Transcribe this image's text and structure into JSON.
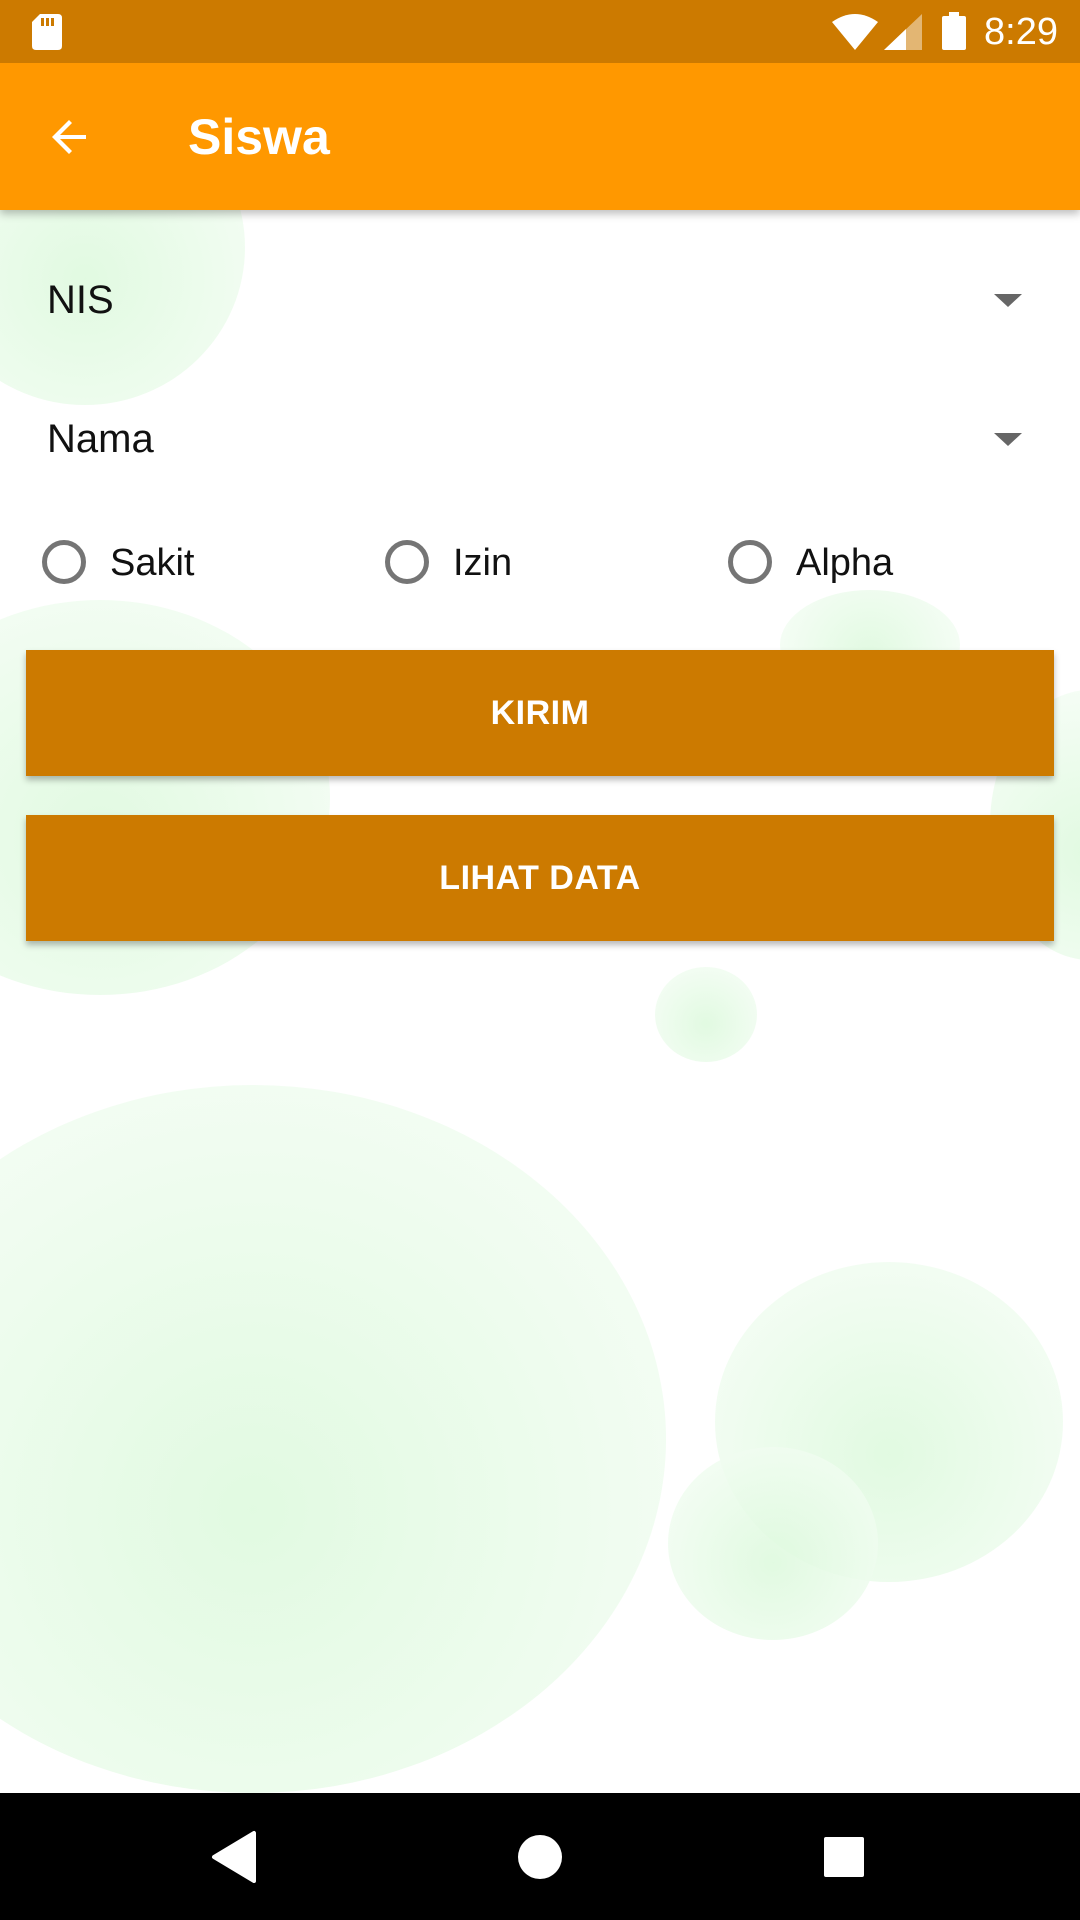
{
  "status_bar": {
    "time": "8:29",
    "icons": [
      "sd-card-icon",
      "wifi-icon",
      "signal-icon",
      "battery-icon"
    ]
  },
  "app_bar": {
    "title": "Siswa",
    "back_icon": "arrow-back-icon"
  },
  "form": {
    "nis_spinner": {
      "value": "NIS"
    },
    "nama_spinner": {
      "value": "Nama"
    },
    "radio_options": [
      {
        "label": "Sakit",
        "checked": false
      },
      {
        "label": "Izin",
        "checked": false
      },
      {
        "label": "Alpha",
        "checked": false
      }
    ],
    "kirim_button": "KIRIM",
    "lihat_data_button": "LIHAT DATA"
  },
  "nav_bar": {
    "icons": [
      "back-triangle-icon",
      "home-circle-icon",
      "recents-square-icon"
    ]
  },
  "colors": {
    "status_bar": "#cc7a00",
    "app_bar": "#ff9800",
    "button": "#cc7a00",
    "bubble": "#dcf9dc"
  }
}
